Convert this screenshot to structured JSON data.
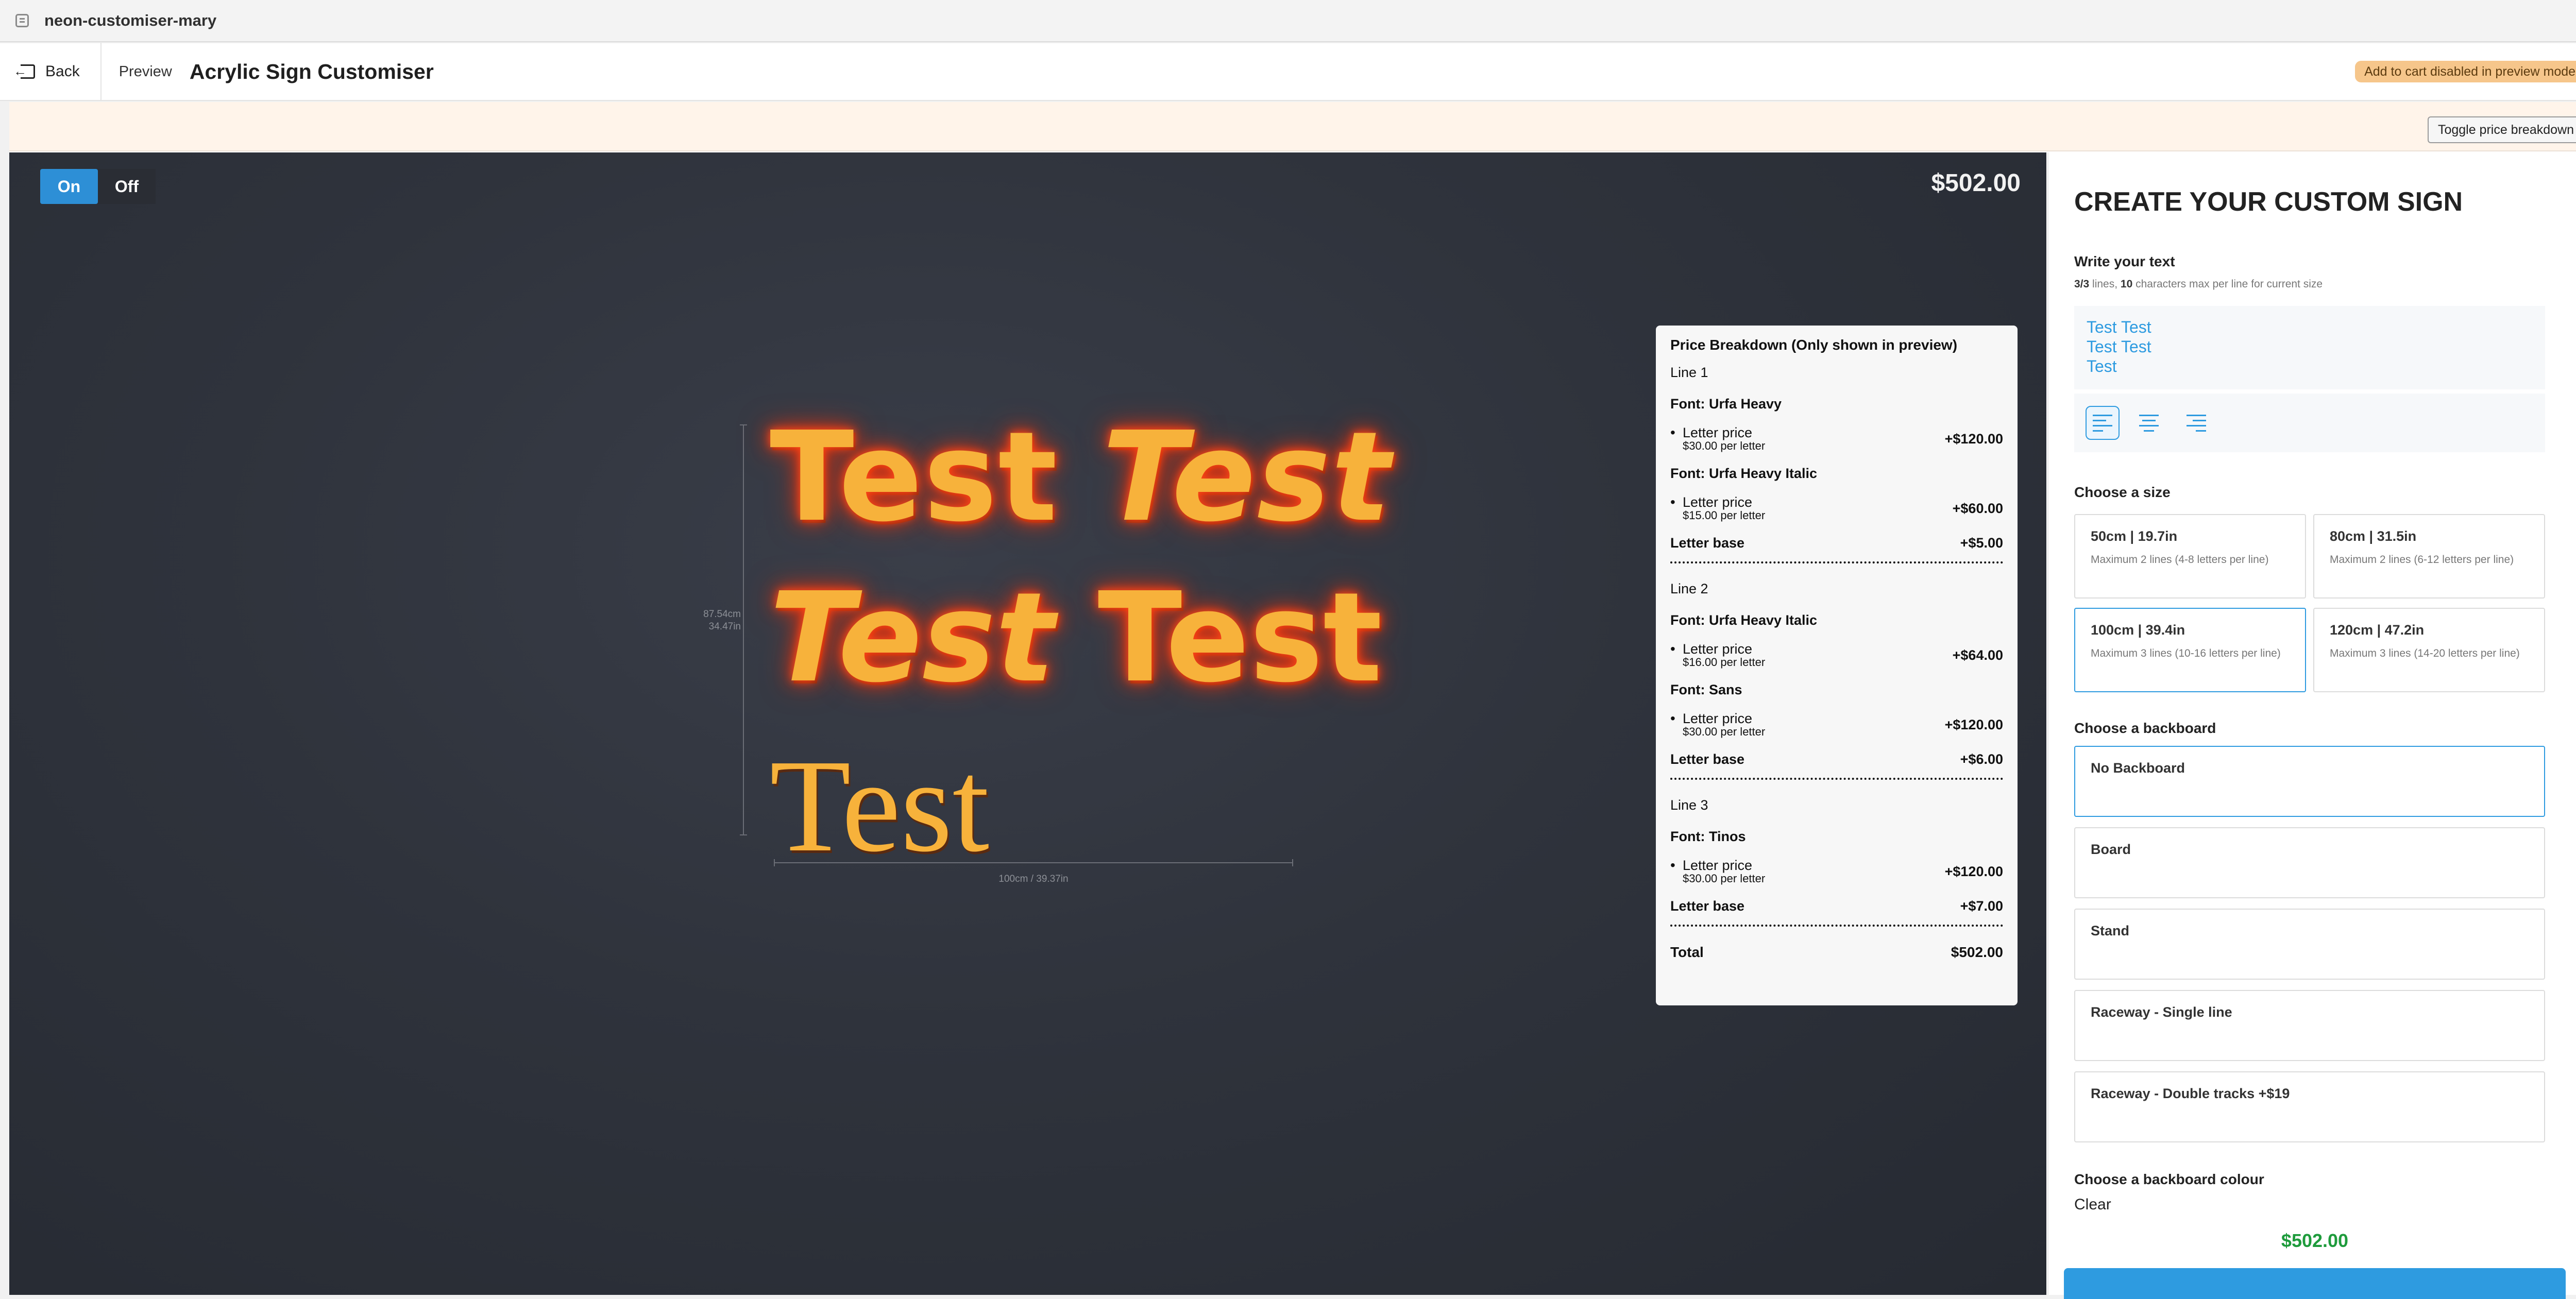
{
  "window": {
    "title": "neon-customiser-mary"
  },
  "header": {
    "back_label": "Back",
    "preview_label": "Preview",
    "page_title": "Acrylic Sign Customiser",
    "cart_notice": "Add to cart disabled in preview mode."
  },
  "toolbar": {
    "toggle_price_label": "Toggle price breakdown"
  },
  "canvas": {
    "on_label": "On",
    "off_label": "Off",
    "price": "$502.00",
    "power_state": "On",
    "lines": [
      {
        "words": [
          "Test",
          "Test"
        ],
        "fonts": [
          "Urfa Heavy",
          "Urfa Heavy Italic"
        ]
      },
      {
        "words": [
          "Test",
          "Test"
        ],
        "fonts": [
          "Urfa Heavy Italic",
          "Sans"
        ]
      },
      {
        "words": [
          "Test"
        ],
        "fonts": [
          "Tinos"
        ]
      }
    ],
    "height_label_cm": "87.54cm",
    "height_label_in": "34.47in",
    "width_label": "100cm / 39.37in",
    "neon_color": "#f7b23b",
    "glow_color": "#e8320e"
  },
  "breakdown": {
    "title": "Price Breakdown (Only shown in preview)",
    "letter_price_label": "Letter price",
    "letter_base_label": "Letter base",
    "total_label": "Total",
    "total_value": "$502.00",
    "lines": [
      {
        "label": "Line 1",
        "fonts": [
          {
            "name": "Font: Urfa Heavy",
            "per": "$30.00 per letter",
            "amount": "+$120.00"
          },
          {
            "name": "Font: Urfa Heavy Italic",
            "per": "$15.00 per letter",
            "amount": "+$60.00"
          }
        ],
        "base": "+$5.00"
      },
      {
        "label": "Line 2",
        "fonts": [
          {
            "name": "Font: Urfa Heavy Italic",
            "per": "$16.00 per letter",
            "amount": "+$64.00"
          },
          {
            "name": "Font: Sans",
            "per": "$30.00 per letter",
            "amount": "+$120.00"
          }
        ],
        "base": "+$6.00"
      },
      {
        "label": "Line 3",
        "fonts": [
          {
            "name": "Font: Tinos",
            "per": "$30.00 per letter",
            "amount": "+$120.00"
          }
        ],
        "base": "+$7.00"
      }
    ]
  },
  "panel": {
    "title": "CREATE YOUR CUSTOM SIGN",
    "write_text_label": "Write your text",
    "lines_used": "3/3",
    "lines_suffix": " lines, ",
    "char_max": "10",
    "char_suffix": " characters max per line for current size",
    "text_lines": [
      "Test Test",
      "Test Test",
      "Test"
    ],
    "alignment_selected": "left",
    "size_label": "Choose a size",
    "sizes": [
      {
        "name": "50cm | 19.7in",
        "desc": "Maximum 2 lines (4-8 letters per line)",
        "selected": false
      },
      {
        "name": "80cm | 31.5in",
        "desc": "Maximum 2 lines (6-12 letters per line)",
        "selected": false
      },
      {
        "name": "100cm | 39.4in",
        "desc": "Maximum 3 lines (10-16 letters per line)",
        "selected": true
      },
      {
        "name": "120cm | 47.2in",
        "desc": "Maximum 3 lines (14-20 letters per line)",
        "selected": false
      }
    ],
    "backboard_label": "Choose a backboard",
    "backboards": [
      {
        "name": "No Backboard",
        "selected": true
      },
      {
        "name": "Board",
        "selected": false
      },
      {
        "name": "Stand",
        "selected": false
      },
      {
        "name": "Raceway - Single line",
        "selected": false
      },
      {
        "name": "Raceway - Double tracks +$19",
        "selected": false
      }
    ],
    "colour_label": "Choose a backboard colour",
    "colour_value": "Clear",
    "footer_price": "$502.00",
    "accent_color": "#2e9be0",
    "price_color": "#1e9b3c"
  }
}
